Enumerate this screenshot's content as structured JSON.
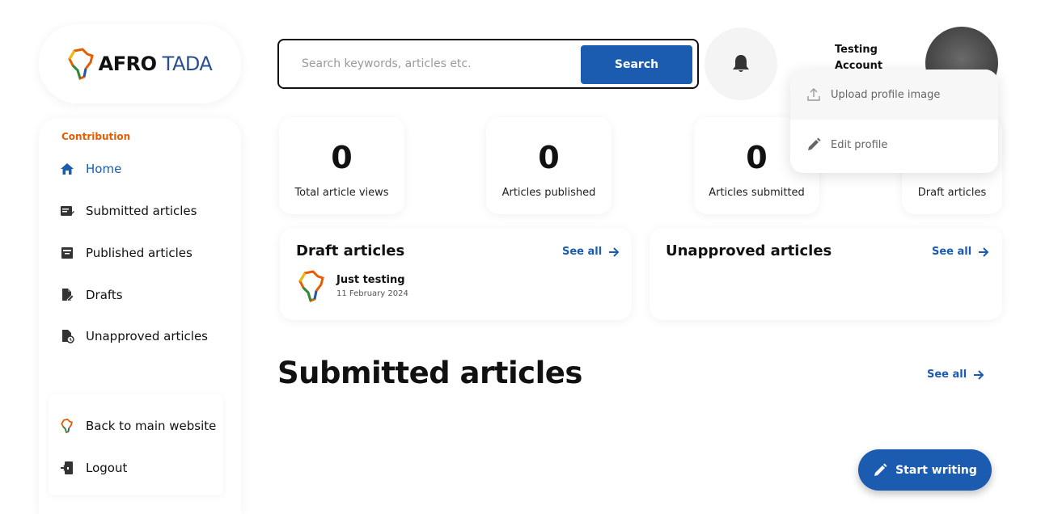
{
  "logo": {
    "part1": "AFRO",
    "part2": " TADA"
  },
  "sidebar": {
    "section_title": "Contribution",
    "items": [
      {
        "label": "Home",
        "icon": "home-icon",
        "active": true
      },
      {
        "label": "Submitted articles",
        "icon": "submitted-articles-icon"
      },
      {
        "label": "Published articles",
        "icon": "published-articles-icon"
      },
      {
        "label": "Drafts",
        "icon": "drafts-icon"
      },
      {
        "label": "Unapproved articles",
        "icon": "unapproved-articles-icon"
      }
    ],
    "bottom": [
      {
        "label": "Back to main website",
        "icon": "afro-tada-logo-icon"
      },
      {
        "label": "Logout",
        "icon": "logout-icon"
      }
    ]
  },
  "search": {
    "placeholder": "Search keywords, articles etc.",
    "button_label": "Search"
  },
  "account": {
    "name_line1": "Testing",
    "name_line2": "Account"
  },
  "stats": [
    {
      "value": "0",
      "label": "Total article views"
    },
    {
      "value": "0",
      "label": "Articles published"
    },
    {
      "value": "0",
      "label": "Articles submitted"
    },
    {
      "value": "0",
      "label": "Draft articles"
    }
  ],
  "draft_panel": {
    "title": "Draft articles",
    "see_all": "See all",
    "articles": [
      {
        "title": "Just testing",
        "date": "11 February 2024"
      }
    ]
  },
  "unapproved_panel": {
    "title": "Unapproved articles",
    "see_all": "See all"
  },
  "submitted_section": {
    "title": "Submitted articles",
    "see_all": "See all"
  },
  "dropdown": {
    "upload_label": "Upload profile image",
    "edit_label": "Edit profile"
  },
  "start_writing_label": "Start writing",
  "colors": {
    "primary": "#1b5bb0",
    "accent": "#e65c00"
  }
}
